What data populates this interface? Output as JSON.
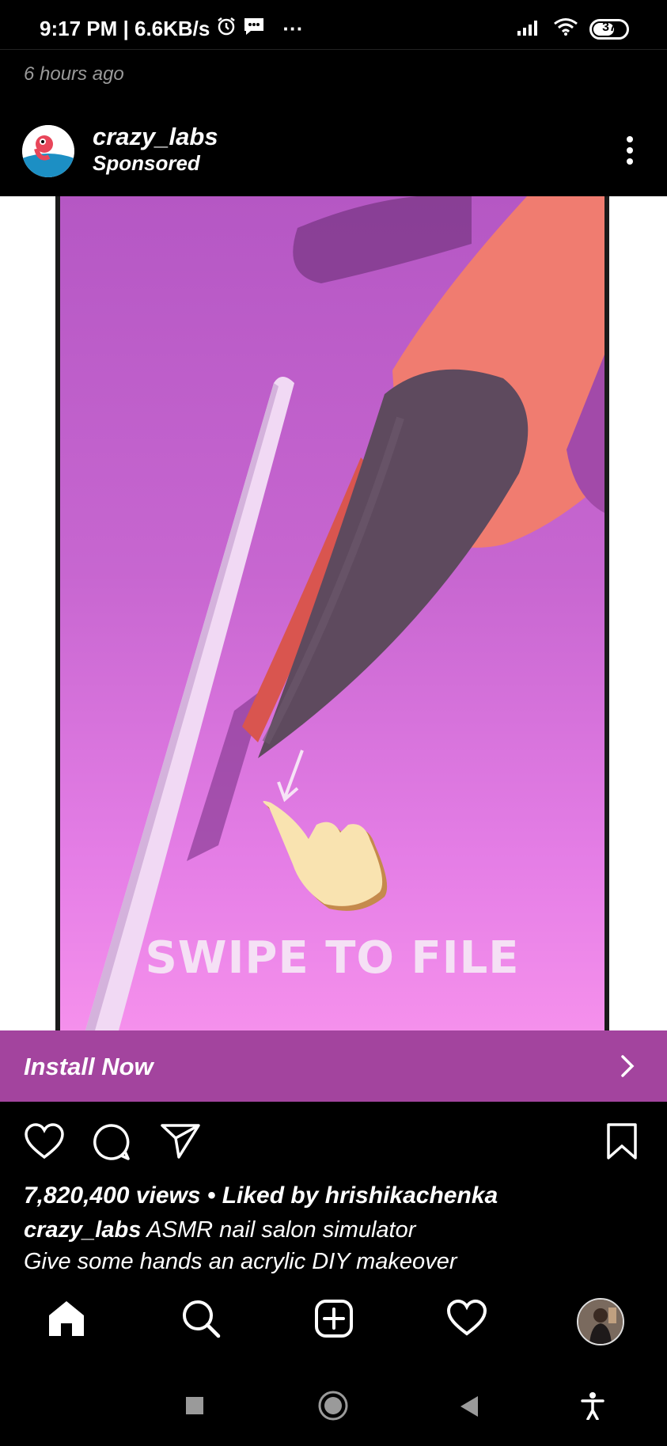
{
  "status_bar": {
    "time_speed": "9:17 PM | 6.6KB/s",
    "more": "···",
    "battery_level": "37",
    "icons": [
      "alarm-icon",
      "message-icon",
      "signal-icon",
      "wifi-icon",
      "battery-icon"
    ]
  },
  "feed": {
    "time_ago": "6 hours ago"
  },
  "post": {
    "username": "crazy_labs",
    "sponsored_label": "Sponsored",
    "media_overlay_text": "SWIPE TO FILE",
    "install_label": "Install Now",
    "views": "7,820,400 views",
    "liked_by_prefix": " • Liked by ",
    "liked_by_user": "hrishikachenka",
    "caption_user": "crazy_labs",
    "caption_text": " ASMR nail salon simulator",
    "caption_line2": "Give some hands an acrylic DIY makeover"
  },
  "colors": {
    "install_bar": "#a3449e",
    "game_background": "#c766d0",
    "nail": "#5e4a5e",
    "finger": "#f07c70"
  }
}
